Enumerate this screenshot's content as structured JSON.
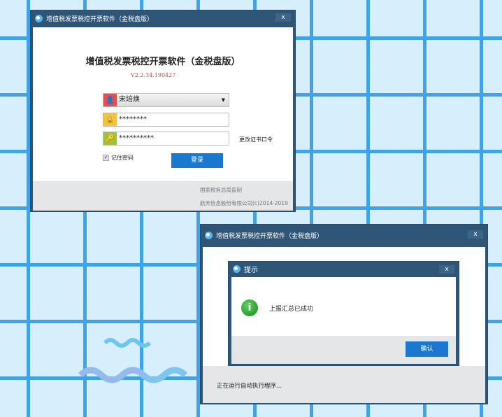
{
  "login_window": {
    "title": "增值税发票税控开票软件（金税盘版）",
    "close": "x",
    "heading": "增值税发票税控开票软件（金税盘版）",
    "version": "V2.2.34.190427",
    "user": {
      "value": "宋培焕",
      "icon": "user-icon"
    },
    "password": {
      "value": "********",
      "icon": "lock-icon"
    },
    "cert_password": {
      "value": "**********",
      "icon": "key-icon"
    },
    "change_cert_link": "更改证书口令",
    "remember_label": "记住密码",
    "remember_checked": true,
    "login_button": "登录",
    "footer_line1": "国家税务总局监制",
    "footer_line2": "航天信息股份有限公司(c)2014-2019"
  },
  "main_window": {
    "title": "增值税发票税控开票软件（金税盘版）",
    "close": "x",
    "status": "正在运行自动执行程序..."
  },
  "dialog": {
    "title": "提示",
    "close": "x",
    "icon": "info-icon",
    "message": "上报汇总已成功",
    "ok_button": "确认"
  }
}
